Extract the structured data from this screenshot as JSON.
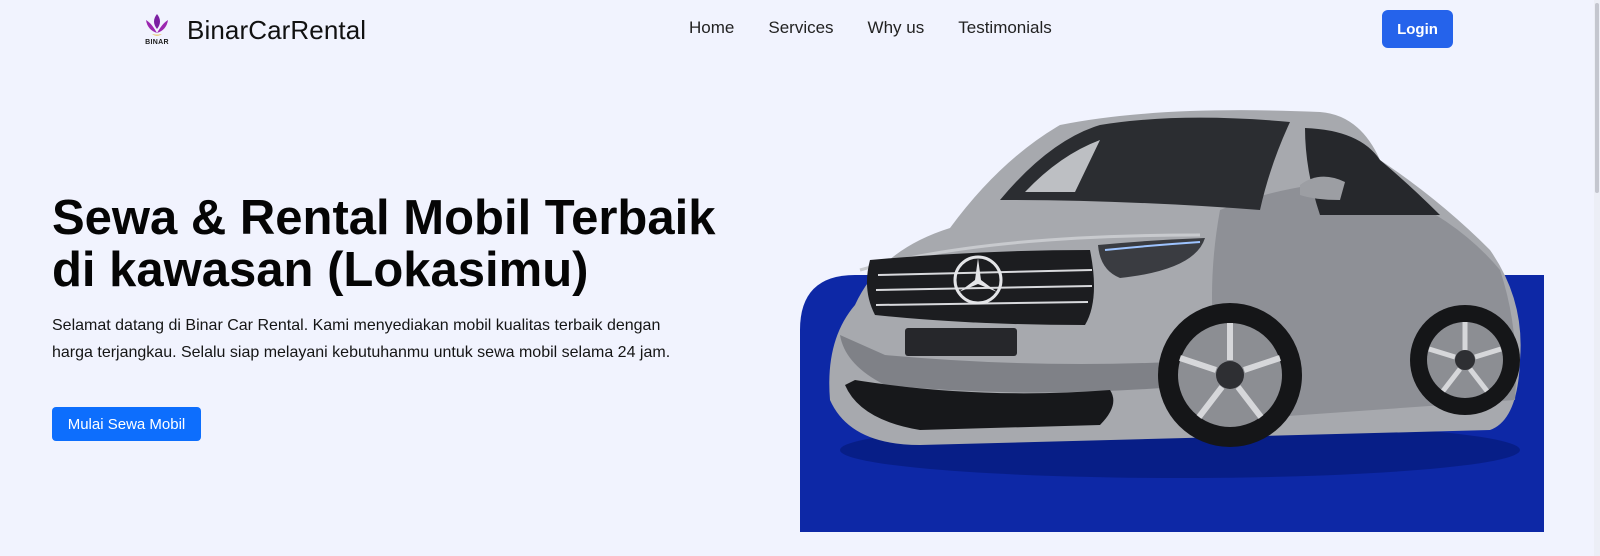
{
  "navbar": {
    "logo_text": "BINAR",
    "brand": "BinarCarRental",
    "links": [
      "Home",
      "Services",
      "Why us",
      "Testimonials"
    ],
    "login_label": "Login"
  },
  "hero": {
    "title_line1": "Sewa & Rental Mobil Terbaik",
    "title_line2": "di kawasan (Lokasimu)",
    "description_line1": "Selamat datang di Binar Car Rental. Kami menyediakan mobil kualitas terbaik dengan",
    "description_line2": "harga terjangkau. Selalu siap melayani kebutuhanmu untuk sewa mobil selama 24 jam.",
    "cta_label": "Mulai Sewa Mobil"
  },
  "colors": {
    "background": "#f1f3fe",
    "primary": "#0d6efd",
    "login": "#2563eb",
    "car_backdrop": "#0d28a6",
    "logo_purple": "#7b1fa2"
  },
  "icons": {
    "logo": "binar-logo-icon",
    "car": "car-image-icon"
  }
}
